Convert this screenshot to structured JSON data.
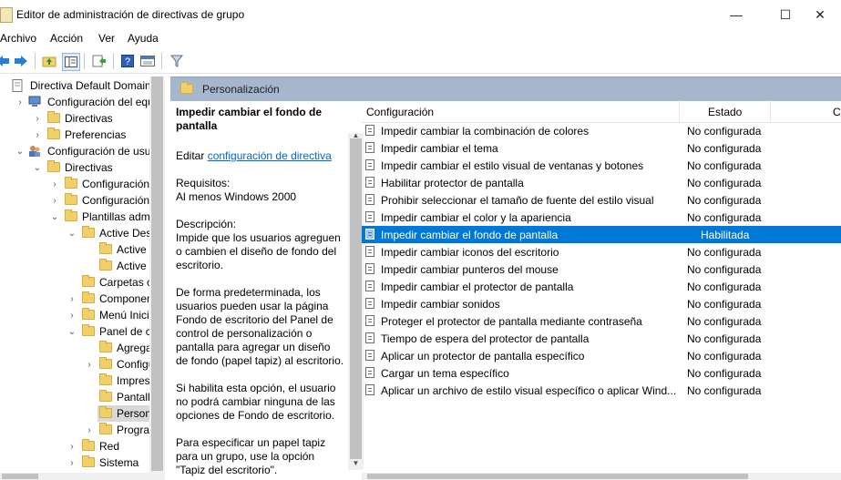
{
  "window": {
    "title": "Editor de administración de directivas de grupo",
    "min": "—",
    "max": "☐",
    "close": "✕"
  },
  "menu": [
    "Archivo",
    "Acción",
    "Ver",
    "Ayuda"
  ],
  "tree": [
    {
      "label": "Directiva Default Domain Co",
      "indent": 0,
      "expander": "",
      "icon": "gpo-icon"
    },
    {
      "label": "Configuración del equipo",
      "indent": 1,
      "expander": "›",
      "icon": "computer-icon"
    },
    {
      "label": "Directivas",
      "indent": 2,
      "expander": "›",
      "icon": "folder-icon"
    },
    {
      "label": "Preferencias",
      "indent": 2,
      "expander": "›",
      "icon": "folder-icon"
    },
    {
      "label": "Configuración de usuario",
      "indent": 1,
      "expander": "⌄",
      "icon": "users-icon"
    },
    {
      "label": "Directivas",
      "indent": 2,
      "expander": "⌄",
      "icon": "folder-icon"
    },
    {
      "label": "Configuración de",
      "indent": 3,
      "expander": "›",
      "icon": "folder-icon"
    },
    {
      "label": "Configuración de",
      "indent": 3,
      "expander": "›",
      "icon": "folder-icon"
    },
    {
      "label": "Plantillas adminis",
      "indent": 3,
      "expander": "⌄",
      "icon": "folder-icon"
    },
    {
      "label": "Active Deskto",
      "indent": 4,
      "expander": "⌄",
      "icon": "folder-icon"
    },
    {
      "label": "Active Des",
      "indent": 5,
      "expander": "",
      "icon": "folder-icon"
    },
    {
      "label": "Active Dire",
      "indent": 5,
      "expander": "",
      "icon": "folder-icon"
    },
    {
      "label": "Carpetas com",
      "indent": 4,
      "expander": "",
      "icon": "folder-icon"
    },
    {
      "label": "Componentes",
      "indent": 4,
      "expander": "›",
      "icon": "folder-icon"
    },
    {
      "label": "Menú Inicio y",
      "indent": 4,
      "expander": "›",
      "icon": "folder-icon"
    },
    {
      "label": "Panel de cont",
      "indent": 4,
      "expander": "⌄",
      "icon": "folder-icon"
    },
    {
      "label": "Agregar o",
      "indent": 5,
      "expander": "",
      "icon": "folder-icon"
    },
    {
      "label": "Configura",
      "indent": 5,
      "expander": "›",
      "icon": "folder-icon"
    },
    {
      "label": "Impresora",
      "indent": 5,
      "expander": "",
      "icon": "folder-icon"
    },
    {
      "label": "Pantalla",
      "indent": 5,
      "expander": "",
      "icon": "folder-icon"
    },
    {
      "label": "Personaliz",
      "indent": 5,
      "expander": "",
      "icon": "folder-icon",
      "selected": true
    },
    {
      "label": "Programas",
      "indent": 5,
      "expander": "›",
      "icon": "folder-icon"
    },
    {
      "label": "Red",
      "indent": 4,
      "expander": "›",
      "icon": "folder-icon"
    },
    {
      "label": "Sistema",
      "indent": 4,
      "expander": "›",
      "icon": "folder-icon"
    }
  ],
  "pane_header": "Personalización",
  "description": {
    "title": "Impedir cambiar el fondo de pantalla",
    "edit_prefix": "Editar ",
    "edit_link": "configuración de directiva",
    "req_label": "Requisitos:",
    "req_value": "Al menos Windows 2000",
    "desc_label": "Descripción:",
    "desc_text": "Impide que los usuarios agreguen o cambien el diseño de fondo del escritorio.",
    "para1": "De forma predeterminada, los usuarios pueden usar la página Fondo de escritorio del Panel de control de personalización o pantalla para agregar un diseño de fondo (papel tapiz) al escritorio.",
    "para2": "Si habilita esta opción, el usuario no podrá cambiar ninguna de las opciones de Fondo de escritorio.",
    "para3": "Para especificar un papel tapiz para un grupo, use la opción \"Tapiz del escritorio\"."
  },
  "list": {
    "col_setting": "Configuración",
    "col_state": "Estado",
    "col_comment": "C",
    "rows": [
      {
        "name": "Impedir cambiar la combinación de colores",
        "state": "No configurada"
      },
      {
        "name": "Impedir cambiar el tema",
        "state": "No configurada"
      },
      {
        "name": "Impedir cambiar el estilo visual de ventanas y botones",
        "state": "No configurada"
      },
      {
        "name": "Habilitar protector de pantalla",
        "state": "No configurada"
      },
      {
        "name": "Prohibir seleccionar el tamaño de fuente del estilo visual",
        "state": "No configurada"
      },
      {
        "name": "Impedir cambiar el color y la apariencia",
        "state": "No configurada"
      },
      {
        "name": "Impedir cambiar el fondo de pantalla",
        "state": "Habilitada",
        "selected": true
      },
      {
        "name": "Impedir cambiar iconos del escritorio",
        "state": "No configurada"
      },
      {
        "name": "Impedir cambiar punteros del mouse",
        "state": "No configurada"
      },
      {
        "name": "Impedir cambiar el protector de pantalla",
        "state": "No configurada"
      },
      {
        "name": "Impedir cambiar sonidos",
        "state": "No configurada"
      },
      {
        "name": "Proteger el protector de pantalla mediante contraseña",
        "state": "No configurada"
      },
      {
        "name": "Tiempo de espera del protector de pantalla",
        "state": "No configurada"
      },
      {
        "name": "Aplicar un protector de pantalla específico",
        "state": "No configurada"
      },
      {
        "name": "Cargar un tema específico",
        "state": "No configurada"
      },
      {
        "name": "Aplicar un archivo de estilo visual específico o aplicar Wind...",
        "state": "No configurada"
      }
    ]
  },
  "colors": {
    "selection": "#0078d7",
    "header": "#a5b6cd",
    "tree_selection": "#d9d9d9",
    "link": "#0066cc"
  }
}
